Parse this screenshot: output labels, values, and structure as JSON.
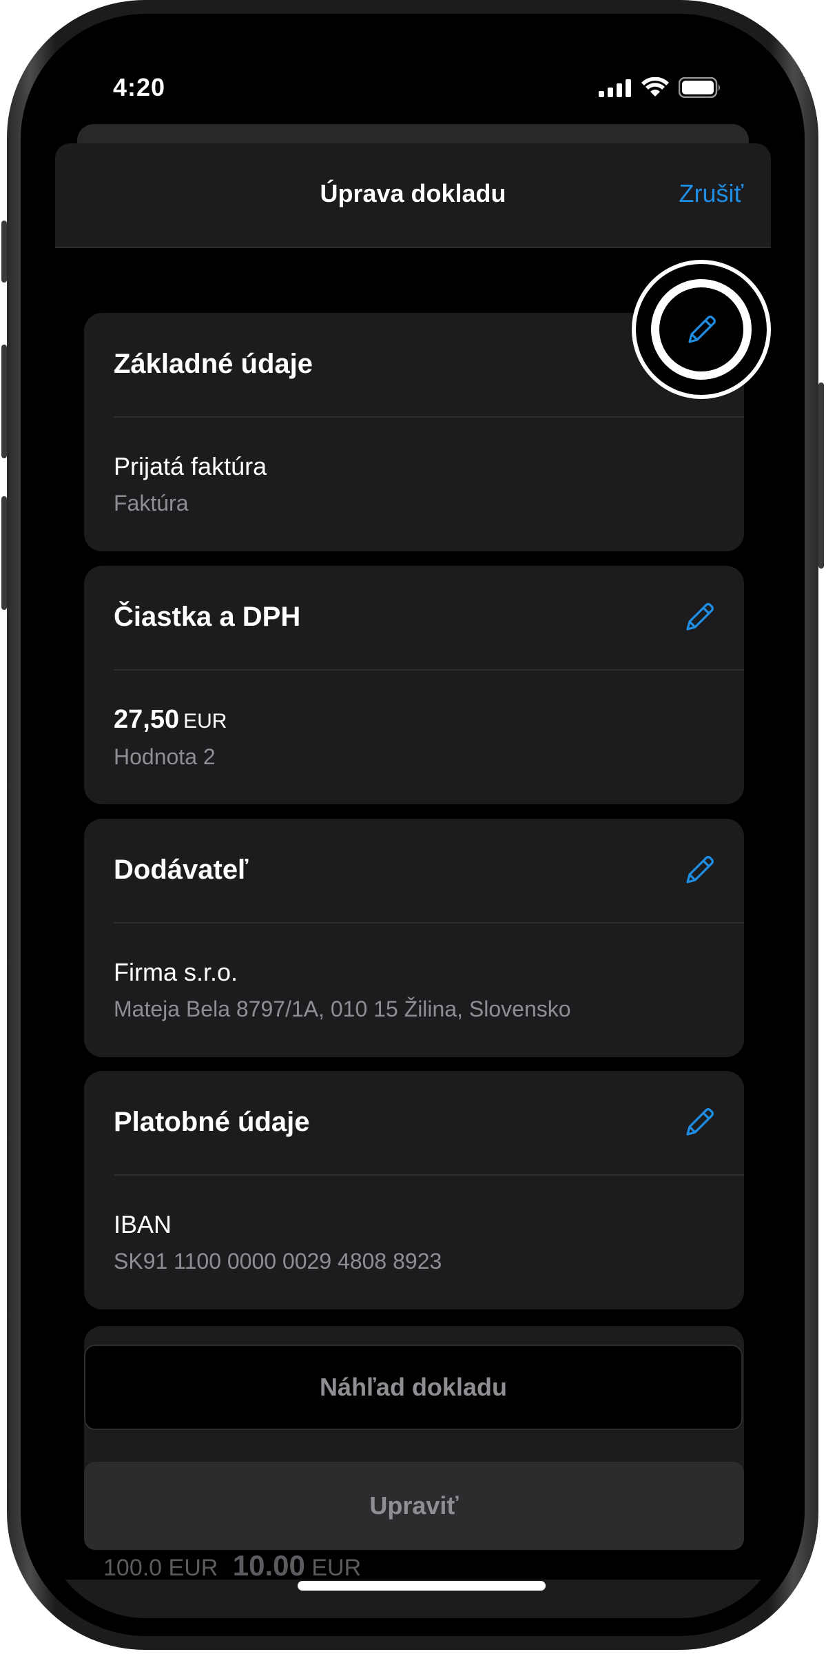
{
  "status_bar": {
    "time": "4:20"
  },
  "nav": {
    "title": "Úprava dokladu",
    "cancel_label": "Zrušiť"
  },
  "cards": [
    {
      "title": "Základné údaje",
      "main": "Prijatá faktúra",
      "sub": "Faktúra"
    },
    {
      "title": "Čiastka a DPH",
      "amount": "27,50",
      "currency": "EUR",
      "sub": "Hodnota 2"
    },
    {
      "title": "Dodávateľ",
      "main": "Firma s.r.o.",
      "sub": "Mateja Bela 8797/1A, 010 15 Žilina, Slovensko"
    },
    {
      "title": "Platobné údaje",
      "main": "IBAN",
      "sub": "SK91 1100 0000 0029 4808 8923"
    }
  ],
  "peek": {
    "left": "100.0 EUR",
    "right": "10.00",
    "right_unit": "EUR"
  },
  "buttons": {
    "preview_label": "Náhľad dokladu",
    "edit_label": "Upraviť"
  },
  "colors": {
    "accent": "#1f8fe6",
    "card_bg": "#1c1c1e",
    "secondary_text": "#8e8e93"
  }
}
